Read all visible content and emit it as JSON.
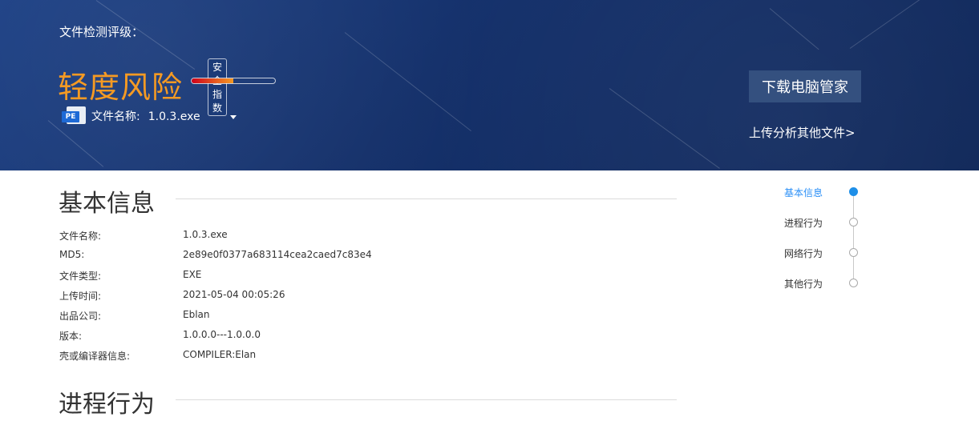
{
  "header": {
    "grade_label": "文件检测评级：",
    "risk_level": "轻度风险",
    "gauge_label": "安全指数",
    "gauge_level_fraction": 0.5,
    "file_icon": "pe-file-icon",
    "file_icon_text": "PE",
    "file_name_label": "文件名称:",
    "file_name_value": "1.0.3.exe",
    "download_button": "下载电脑管家",
    "upload_link": "上传分析其他文件>"
  },
  "sections": {
    "basic_info_title": "基本信息",
    "process_title": "进程行为"
  },
  "basic_info": [
    {
      "label": "文件名称:",
      "value": "1.0.3.exe"
    },
    {
      "label": "MD5:",
      "value": "2e89e0f0377a683114cea2caed7c83e4"
    },
    {
      "label": "文件类型:",
      "value": "EXE"
    },
    {
      "label": "上传时间:",
      "value": "2021-05-04 00:05:26"
    },
    {
      "label": "出品公司:",
      "value": "Eblan"
    },
    {
      "label": "版本:",
      "value": "1.0.0.0---1.0.0.0"
    },
    {
      "label": "壳或编译器信息:",
      "value": "COMPILER:Elan"
    }
  ],
  "side_nav": [
    {
      "label": "基本信息",
      "active": true
    },
    {
      "label": "进程行为",
      "active": false
    },
    {
      "label": "网络行为",
      "active": false
    },
    {
      "label": "其他行为",
      "active": false
    }
  ],
  "colors": {
    "header_bg": "#14306a",
    "risk_orange": "#f59a23",
    "nav_active": "#2a8ff7"
  }
}
